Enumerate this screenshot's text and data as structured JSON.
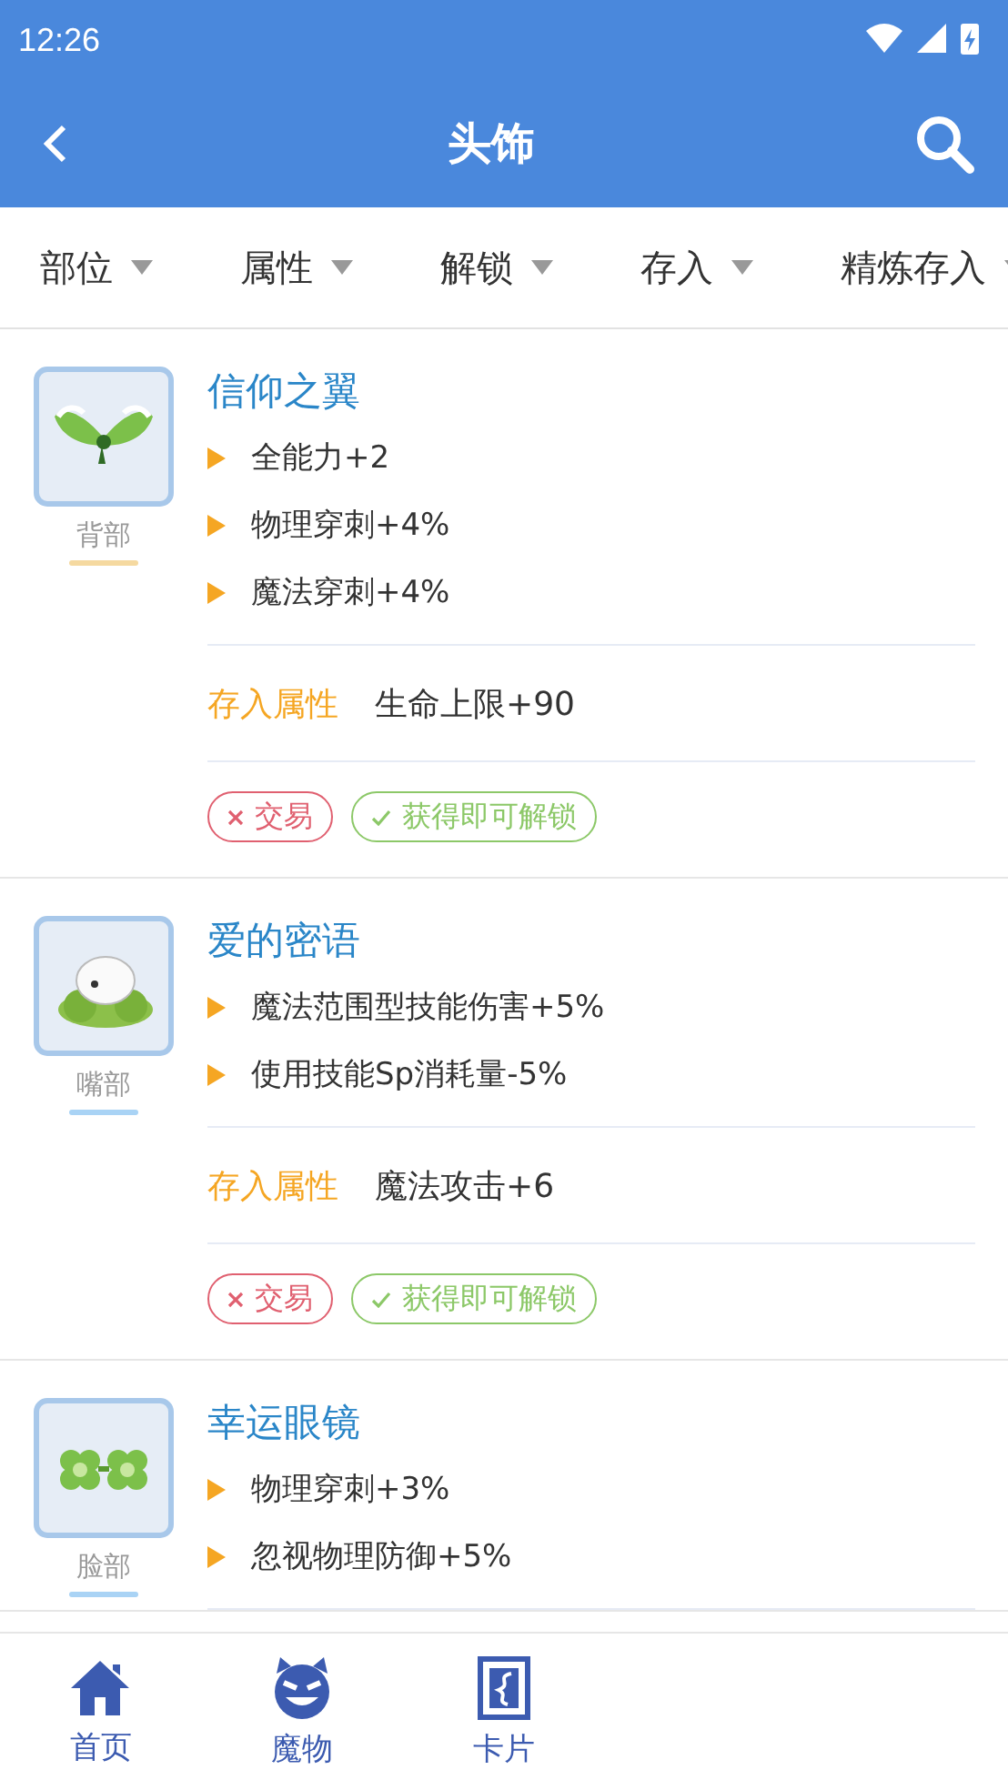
{
  "status_bar": {
    "time": "12:26"
  },
  "header": {
    "title": "头饰"
  },
  "filters": [
    {
      "label": "部位"
    },
    {
      "label": "属性"
    },
    {
      "label": "解锁"
    },
    {
      "label": "存入"
    },
    {
      "label": "精炼存入"
    }
  ],
  "items": [
    {
      "kind": "wings",
      "name": "信仰之翼",
      "part": "背部",
      "color": "#f5d9a0",
      "stats": [
        "全能力+2",
        "物理穿刺+4%",
        "魔法穿刺+4%"
      ],
      "stored_label": "存入属性",
      "stored_value": "生命上限+90",
      "tags": [
        {
          "kind": "no",
          "label": "交易"
        },
        {
          "kind": "yes",
          "label": "获得即可解锁"
        }
      ]
    },
    {
      "kind": "bun",
      "name": "爱的密语",
      "part": "嘴部",
      "color": "#a9d3f5",
      "stats": [
        "魔法范围型技能伤害+5%",
        "使用技能Sp消耗量-5%"
      ],
      "stored_label": "存入属性",
      "stored_value": "魔法攻击+6",
      "tags": [
        {
          "kind": "no",
          "label": "交易"
        },
        {
          "kind": "yes",
          "label": "获得即可解锁"
        }
      ]
    },
    {
      "kind": "glasses",
      "name": "幸运眼镜",
      "part": "脸部",
      "color": "#a9d3f5",
      "stats": [
        "物理穿刺+3%",
        "忽视物理防御+5%"
      ]
    }
  ],
  "nav": [
    {
      "kind": "home",
      "label": "首页"
    },
    {
      "kind": "monster",
      "label": "魔物"
    },
    {
      "kind": "card",
      "label": "卡片"
    }
  ]
}
